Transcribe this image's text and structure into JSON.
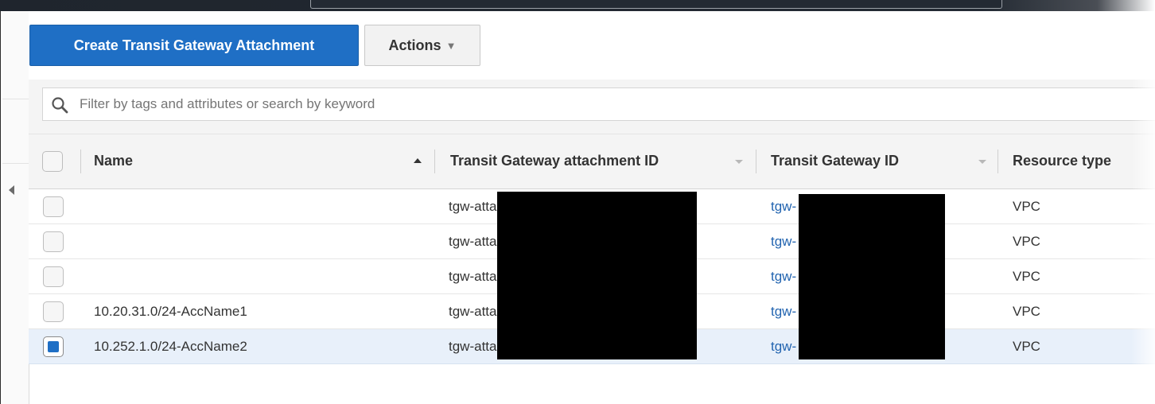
{
  "toolbar": {
    "create_label": "Create Transit Gateway Attachment",
    "actions_label": "Actions",
    "actions_caret": "▼"
  },
  "search": {
    "placeholder": "Filter by tags and attributes or search by keyword"
  },
  "table": {
    "columns": [
      {
        "label": "Name",
        "sort": "ascending"
      },
      {
        "label": "Transit Gateway attachment ID",
        "sort": "none"
      },
      {
        "label": "Transit Gateway ID",
        "sort": "none"
      },
      {
        "label": "Resource type",
        "sort": "none"
      }
    ],
    "rows": [
      {
        "name": "",
        "attachment_id": "tgw-attach-",
        "gateway_id": "tgw-",
        "resource_type": "VPC",
        "selected": false
      },
      {
        "name": "",
        "attachment_id": "tgw-attach-",
        "gateway_id": "tgw-",
        "resource_type": "VPC",
        "selected": false
      },
      {
        "name": "",
        "attachment_id": "tgw-attach-",
        "gateway_id": "tgw-",
        "resource_type": "VPC",
        "selected": false
      },
      {
        "name": "10.20.31.0/24-AccName1",
        "attachment_id": "tgw-attach-",
        "gateway_id": "tgw-",
        "resource_type": "VPC",
        "selected": false
      },
      {
        "name": "10.252.1.0/24-AccName2",
        "attachment_id": "tgw-attach-",
        "gateway_id": "tgw-",
        "resource_type": "VPC",
        "selected": true
      }
    ]
  },
  "colors": {
    "primary_button": "#1f6fc5",
    "link": "#2264b0",
    "selected_row": "#e8f0fa"
  },
  "icons": {
    "search": "search-icon",
    "collapse": "collapse-left-icon",
    "dropdown": "chevron-down-icon"
  }
}
